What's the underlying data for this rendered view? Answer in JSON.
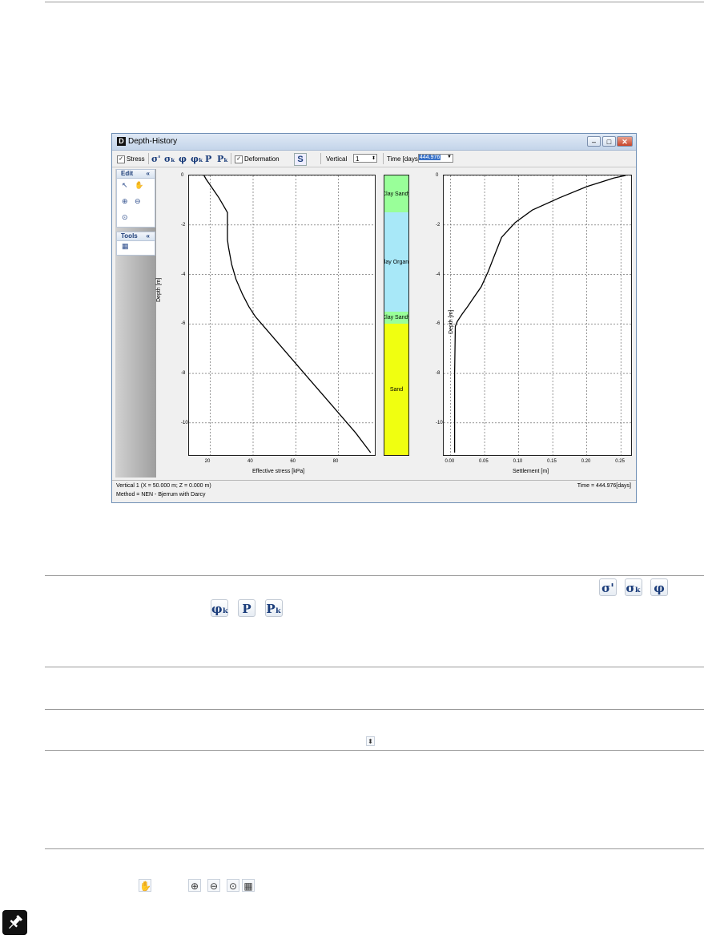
{
  "window": {
    "title": "Depth-History",
    "app_letter": "D"
  },
  "toolbar": {
    "stress_label": "Stress",
    "icons": [
      "σ'",
      "σₖ",
      "φ",
      "φₖ",
      "P",
      "Pₖ"
    ],
    "deformation_label": "Deformation",
    "s_label": "S",
    "vertical_label": "Vertical",
    "vertical_value": "1",
    "time_label": "Time [days]",
    "time_value": "444.976"
  },
  "sidebar": {
    "edit_label": "Edit",
    "tools_label": "Tools"
  },
  "layers": [
    {
      "name": "Clay Sandy",
      "top": 0,
      "bottom": -1.5,
      "color": "#99ff99"
    },
    {
      "name": "Clay Organic",
      "top": -1.5,
      "bottom": -5.5,
      "color": "#a8e8f8"
    },
    {
      "name": "Clay Sandy",
      "top": -5.5,
      "bottom": -6.0,
      "color": "#99ff99"
    },
    {
      "name": "Sand",
      "top": -6.0,
      "bottom": -11.3,
      "color": "#f0ff10"
    }
  ],
  "chart_data": [
    {
      "type": "line",
      "xlabel": "Effective stress [kPa]",
      "ylabel": "Depth [m]",
      "xticks": [
        20,
        40,
        60,
        80
      ],
      "yticks": [
        0,
        -2,
        -4,
        -6,
        -8,
        -10
      ],
      "xlim": [
        10,
        97
      ],
      "ylim": [
        -11.3,
        0
      ],
      "grid": true,
      "series": [
        {
          "x": [
            17,
            18,
            20,
            22,
            24,
            26,
            28,
            28,
            28,
            28.5,
            30,
            32,
            35,
            38,
            41,
            44,
            55,
            66,
            77,
            88,
            95
          ],
          "y": [
            0,
            -0.15,
            -0.4,
            -0.65,
            -0.9,
            -1.2,
            -1.5,
            -1.9,
            -2.6,
            -2.9,
            -3.6,
            -4.2,
            -4.8,
            -5.3,
            -5.7,
            -6.0,
            -7.1,
            -8.2,
            -9.3,
            -10.4,
            -11.2
          ]
        }
      ]
    },
    {
      "type": "line",
      "xlabel": "Settlement [m]",
      "ylabel": "Depth [m]",
      "xticks": [
        "0.00",
        "0.05",
        "0.10",
        "0.15",
        "0.20",
        "0.25"
      ],
      "yticks": [
        0,
        -2,
        -4,
        -6,
        -8,
        -10
      ],
      "xlim": [
        -0.01,
        0.265
      ],
      "ylim": [
        -11.3,
        0
      ],
      "grid": true,
      "series": [
        {
          "x": [
            0.257,
            0.24,
            0.2,
            0.16,
            0.12,
            0.095,
            0.075,
            0.065,
            0.055,
            0.045,
            0.035,
            0.025,
            0.017,
            0.01,
            0.007,
            0.006,
            0.006
          ],
          "y": [
            0,
            -0.1,
            -0.45,
            -0.9,
            -1.4,
            -1.9,
            -2.5,
            -3.2,
            -3.9,
            -4.5,
            -4.9,
            -5.3,
            -5.6,
            -5.9,
            -6.1,
            -8.0,
            -11.2
          ]
        }
      ]
    }
  ],
  "status": {
    "vertical_info": "Vertical 1 (X = 50.000 m; Z = 0.000 m)",
    "method": "Method = NEN - Bjerrum with Darcy",
    "time": "Time = 444.976[days]"
  }
}
